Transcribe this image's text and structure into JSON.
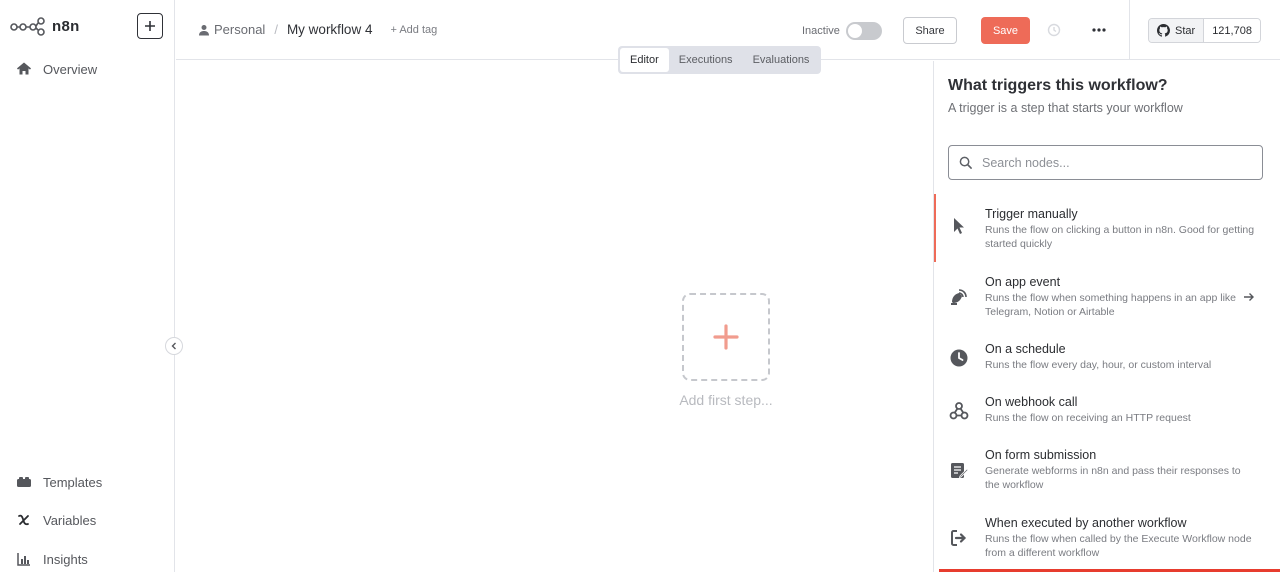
{
  "app": {
    "logo_text": "n8n"
  },
  "sidebar": {
    "top_items": [
      {
        "label": "Overview",
        "icon": "home-icon"
      }
    ],
    "bottom_items": [
      {
        "label": "Templates",
        "icon": "templates-icon"
      },
      {
        "label": "Variables",
        "icon": "variable-icon"
      },
      {
        "label": "Insights",
        "icon": "chart-icon"
      }
    ]
  },
  "header": {
    "project": "Personal",
    "separator": "/",
    "workflow_name": "My workflow 4",
    "add_tag": "+ Add tag",
    "status": "Inactive",
    "share_label": "Share",
    "save_label": "Save",
    "github_star_label": "Star",
    "github_star_count": "121,708"
  },
  "tabs": [
    {
      "label": "Editor",
      "active": true
    },
    {
      "label": "Executions",
      "active": false
    },
    {
      "label": "Evaluations",
      "active": false
    }
  ],
  "canvas": {
    "add_step_label": "Add first step..."
  },
  "panel": {
    "title": "What triggers this workflow?",
    "subtitle": "A trigger is a step that starts your workflow",
    "search_placeholder": "Search nodes...",
    "triggers": [
      {
        "title": "Trigger manually",
        "desc": "Runs the flow on clicking a button in n8n. Good for getting started quickly",
        "icon": "cursor-icon"
      },
      {
        "title": "On app event",
        "desc": "Runs the flow when something happens in an app like Telegram, Notion or Airtable",
        "icon": "satellite-icon"
      },
      {
        "title": "On a schedule",
        "desc": "Runs the flow every day, hour, or custom interval",
        "icon": "clock-icon"
      },
      {
        "title": "On webhook call",
        "desc": "Runs the flow on receiving an HTTP request",
        "icon": "webhook-icon"
      },
      {
        "title": "On form submission",
        "desc": "Generate webforms in n8n and pass their responses to the workflow",
        "icon": "form-icon"
      },
      {
        "title": "When executed by another workflow",
        "desc": "Runs the flow when called by the Execute Workflow node from a different workflow",
        "icon": "sign-in-icon"
      }
    ]
  },
  "colors": {
    "accent": "#ee6b58",
    "active_bar": "#e73c2e"
  }
}
